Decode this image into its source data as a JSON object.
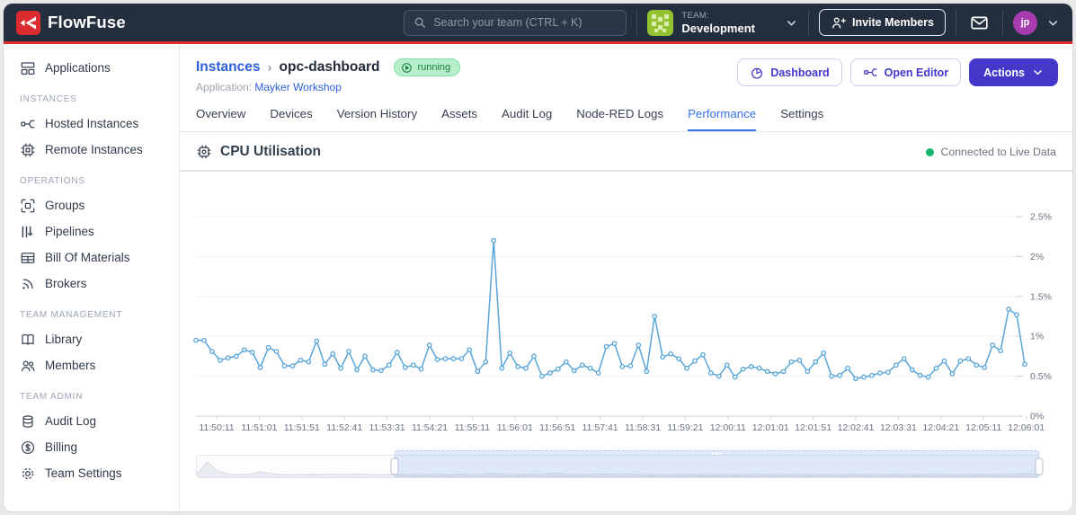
{
  "navbar": {
    "brand": "FlowFuse",
    "search_placeholder": "Search your team (CTRL + K)",
    "team_label": "TEAM:",
    "team_name": "Development",
    "invite_button": "Invite Members",
    "avatar_initials": "jp"
  },
  "sidebar": {
    "top_items": [
      {
        "label": "Applications",
        "icon": "applications-icon"
      }
    ],
    "sections": [
      {
        "header": "INSTANCES",
        "items": [
          {
            "label": "Hosted Instances",
            "icon": "hosted-instances-icon"
          },
          {
            "label": "Remote Instances",
            "icon": "remote-instances-icon"
          }
        ]
      },
      {
        "header": "OPERATIONS",
        "items": [
          {
            "label": "Groups",
            "icon": "groups-icon"
          },
          {
            "label": "Pipelines",
            "icon": "pipelines-icon"
          },
          {
            "label": "Bill Of Materials",
            "icon": "bill-of-materials-icon"
          },
          {
            "label": "Brokers",
            "icon": "brokers-icon"
          }
        ]
      },
      {
        "header": "TEAM MANAGEMENT",
        "items": [
          {
            "label": "Library",
            "icon": "library-icon"
          },
          {
            "label": "Members",
            "icon": "members-icon"
          }
        ]
      },
      {
        "header": "TEAM ADMIN",
        "items": [
          {
            "label": "Audit Log",
            "icon": "audit-log-icon"
          },
          {
            "label": "Billing",
            "icon": "billing-icon"
          },
          {
            "label": "Team Settings",
            "icon": "team-settings-icon"
          }
        ]
      }
    ]
  },
  "header": {
    "breadcrumb_parent": "Instances",
    "breadcrumb_separator": "›",
    "breadcrumb_current": "opc-dashboard",
    "status_badge": "running",
    "application_label": "Application:",
    "application_name": "Mayker Workshop",
    "buttons": {
      "dashboard": {
        "label": "Dashboard",
        "icon": "pie-chart-icon"
      },
      "open_editor": {
        "label": "Open Editor",
        "icon": "node-red-editor-icon"
      },
      "actions": {
        "label": "Actions",
        "icon": "chevron-down-icon"
      }
    }
  },
  "tabs": {
    "items": [
      "Overview",
      "Devices",
      "Version History",
      "Assets",
      "Audit Log",
      "Node-RED Logs",
      "Performance",
      "Settings"
    ],
    "active": "Performance"
  },
  "panel": {
    "title": "CPU Utilisation",
    "title_icon": "cpu-chip-icon",
    "status": "Connected to Live Data",
    "status_color": "#12b76a"
  },
  "colors": {
    "navbar_bg": "#232e3e",
    "brand_red": "#dd2c30",
    "link_blue": "#2d5dd7",
    "tab_blue": "#3574f0",
    "indigo": "#4338ca",
    "badge_green_bg": "#b7efca",
    "badge_green_text": "#1b7a47",
    "chart_line": "#57a5d9"
  },
  "chart_data": {
    "type": "line",
    "title": "CPU Utilisation",
    "unit": "%",
    "grid": "horizontal",
    "legend": "none",
    "ylim": [
      0,
      2.95
    ],
    "y_ticks": [
      "0%",
      "0.5%",
      "1%",
      "1.5%",
      "2%",
      "2.5%"
    ],
    "x_ticks": [
      "11:50:11",
      "11:51:01",
      "11:51:51",
      "11:52:41",
      "11:53:31",
      "11:54:21",
      "11:55:11",
      "11:56:01",
      "11:56:51",
      "11:57:41",
      "11:58:31",
      "11:59:21",
      "12:00:11",
      "12:01:01",
      "12:01:51",
      "12:02:41",
      "12:03:31",
      "12:04:21",
      "12:05:11",
      "12:06:01"
    ],
    "series": [
      {
        "name": "CPU",
        "color": "#57a5d9",
        "values": [
          0.95,
          0.95,
          0.81,
          0.7,
          0.73,
          0.75,
          0.83,
          0.8,
          0.61,
          0.86,
          0.81,
          0.63,
          0.63,
          0.7,
          0.68,
          0.94,
          0.65,
          0.78,
          0.6,
          0.81,
          0.58,
          0.75,
          0.58,
          0.57,
          0.64,
          0.8,
          0.61,
          0.64,
          0.59,
          0.89,
          0.71,
          0.72,
          0.72,
          0.72,
          0.83,
          0.56,
          0.68,
          2.2,
          0.6,
          0.79,
          0.62,
          0.6,
          0.75,
          0.5,
          0.54,
          0.59,
          0.68,
          0.57,
          0.64,
          0.6,
          0.54,
          0.87,
          0.91,
          0.62,
          0.63,
          0.89,
          0.56,
          1.25,
          0.74,
          0.78,
          0.72,
          0.6,
          0.69,
          0.77,
          0.54,
          0.5,
          0.64,
          0.49,
          0.59,
          0.62,
          0.6,
          0.56,
          0.53,
          0.56,
          0.68,
          0.7,
          0.56,
          0.68,
          0.79,
          0.5,
          0.51,
          0.6,
          0.47,
          0.49,
          0.51,
          0.54,
          0.55,
          0.64,
          0.72,
          0.58,
          0.51,
          0.49,
          0.6,
          0.69,
          0.53,
          0.69,
          0.72,
          0.64,
          0.61,
          0.89,
          0.82,
          1.34,
          1.27,
          0.65
        ]
      }
    ],
    "overview": {
      "selection_start_pct": 23.5,
      "selection_end_pct": 100,
      "values": [
        0.45,
        2.35,
        0.9,
        0.35,
        0.3,
        0.35,
        0.75,
        0.5,
        0.32,
        0.28,
        0.3,
        0.34,
        0.3,
        0.38,
        0.3,
        0.42,
        0.32,
        0.28,
        0.3,
        0.34,
        0.3,
        0.28,
        0.31,
        0.33,
        0.3,
        0.36,
        0.3,
        0.28,
        0.46,
        0.3,
        0.28,
        0.31,
        0.33,
        0.3,
        0.56,
        0.3,
        0.28,
        0.31,
        0.34,
        0.36,
        0.3,
        0.42,
        0.3,
        0.28,
        0.3,
        0.31,
        0.28,
        0.3,
        0.28,
        0.26,
        0.31,
        0.28,
        0.3,
        0.33,
        0.3,
        0.28,
        0.31,
        0.34,
        0.28,
        0.3,
        0.3,
        0.28,
        0.33,
        0.3,
        0.28,
        0.3,
        0.32,
        0.3,
        0.28,
        0.3,
        0.35,
        0.3,
        0.3,
        0.28,
        0.31,
        0.3,
        0.28,
        0.3,
        0.45,
        0.42,
        0.3
      ]
    }
  }
}
